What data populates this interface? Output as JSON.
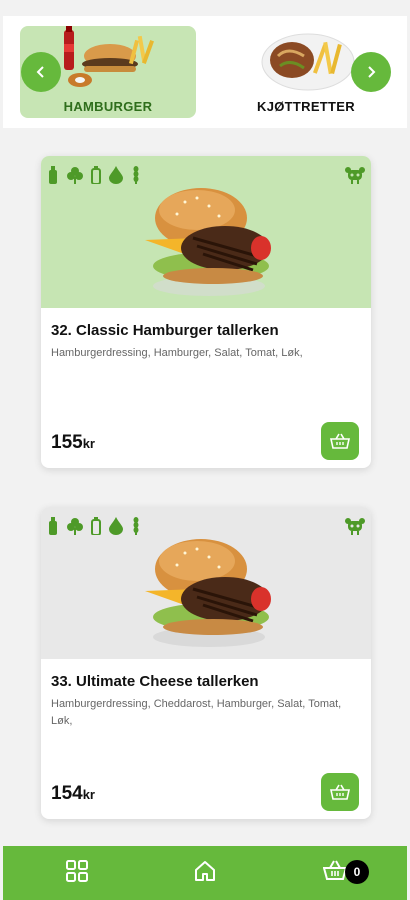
{
  "categories": [
    {
      "label": "HAMBURGER",
      "active": true
    },
    {
      "label": "KJØTTRETTER",
      "active": false
    }
  ],
  "products": [
    {
      "title": "32. Classic Hamburger tallerken",
      "description": "Hamburgerdressing, Hamburger, Salat, Tomat, Løk,",
      "price": "155",
      "currency": "kr",
      "image_background": "#c6e5b3"
    },
    {
      "title": "33. Ultimate Cheese tallerken",
      "description": "Hamburgerdressing, Cheddarost, Hamburger, Salat, Tomat, Løk,",
      "price": "154",
      "currency": "kr",
      "image_background": "#e8e8e8"
    }
  ],
  "allergen_icons": [
    "bottle-icon",
    "clover-icon",
    "milk-icon",
    "drop-icon",
    "wheat-icon"
  ],
  "nav": {
    "items": [
      "grid-icon",
      "home-icon",
      "cart-icon"
    ],
    "cart_count": "0"
  },
  "colors": {
    "accent": "#66b93c",
    "active_category_bg": "#c7e5b4",
    "nav_bg": "#66b93c"
  }
}
